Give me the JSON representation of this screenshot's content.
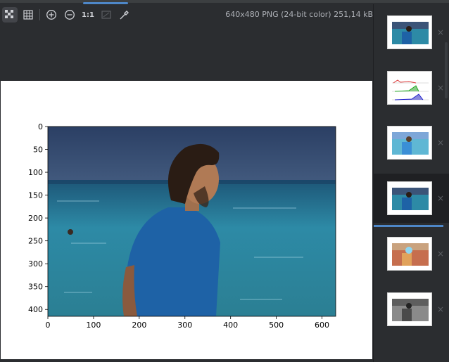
{
  "toolbar": {
    "icons": [
      "chessboard-icon",
      "grid-icon",
      "zoom-in-icon",
      "zoom-out-icon",
      "actual-size-icon",
      "fit-window-icon",
      "color-picker-icon"
    ],
    "actual_size_label": "1:1",
    "file_info": "640x480 PNG (24-bit color) 251,14 kB"
  },
  "plot": {
    "x_ticks": [
      "0",
      "100",
      "200",
      "300",
      "400",
      "500",
      "600"
    ],
    "y_ticks": [
      "0",
      "50",
      "100",
      "150",
      "200",
      "250",
      "300",
      "350",
      "400"
    ]
  },
  "thumbnails": [
    {
      "kind": "photo",
      "selected": false
    },
    {
      "kind": "histogram",
      "selected": false
    },
    {
      "kind": "photo-bright",
      "selected": false
    },
    {
      "kind": "photo",
      "selected": true
    },
    {
      "kind": "photo-inverted",
      "selected": false
    },
    {
      "kind": "photo-gray",
      "selected": false
    }
  ],
  "close_glyph": "×"
}
